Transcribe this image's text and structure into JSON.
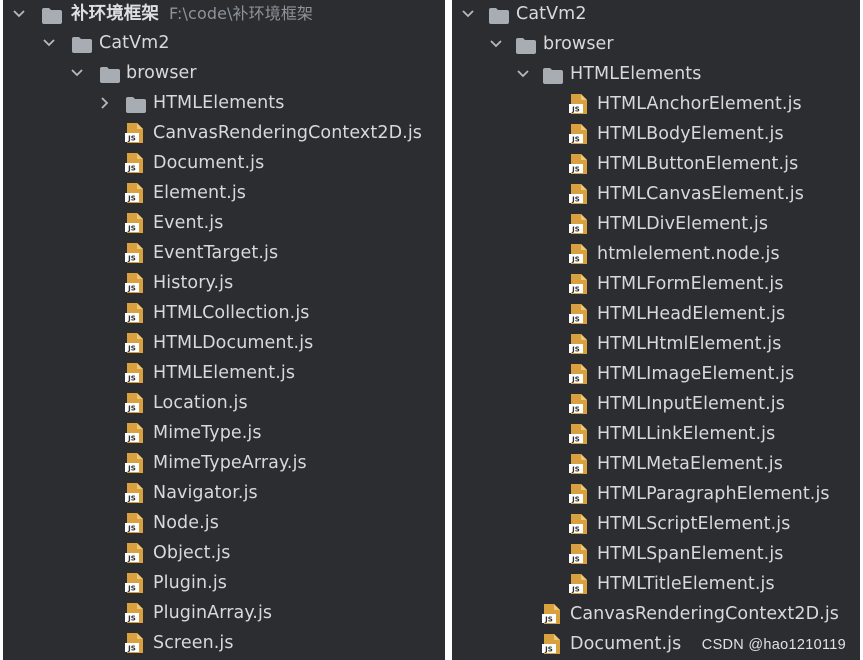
{
  "colors": {
    "panel_background": "#2b2d30",
    "text": "#d6d9de",
    "path_hint": "#8e939a",
    "folder_icon": "#a8adb4",
    "js_icon_fill": "#d8a03e",
    "js_icon_badge": "#ffffff",
    "chevron": "#b6bac1"
  },
  "left_panel": {
    "project": {
      "name": "补环境框架",
      "path": "F:\\code\\补环境框架"
    },
    "catvm2": "CatVm2",
    "browser": "browser",
    "html_elements_collapsed": "HTMLElements",
    "files": [
      "CanvasRenderingContext2D.js",
      "Document.js",
      "Element.js",
      "Event.js",
      "EventTarget.js",
      "History.js",
      "HTMLCollection.js",
      "HTMLDocument.js",
      "HTMLElement.js",
      "Location.js",
      "MimeType.js",
      "MimeTypeArray.js",
      "Navigator.js",
      "Node.js",
      "Object.js",
      "Plugin.js",
      "PluginArray.js",
      "Screen.js"
    ]
  },
  "right_panel": {
    "catvm2": "CatVm2",
    "browser": "browser",
    "html_elements_expanded": "HTMLElements",
    "element_files": [
      "HTMLAnchorElement.js",
      "HTMLBodyElement.js",
      "HTMLButtonElement.js",
      "HTMLCanvasElement.js",
      "HTMLDivElement.js",
      "htmlelement.node.js",
      "HTMLFormElement.js",
      "HTMLHeadElement.js",
      "HTMLHtmlElement.js",
      "HTMLImageElement.js",
      "HTMLInputElement.js",
      "HTMLLinkElement.js",
      "HTMLMetaElement.js",
      "HTMLParagraphElement.js",
      "HTMLScriptElement.js",
      "HTMLSpanElement.js",
      "HTMLTitleElement.js"
    ],
    "browser_files": [
      "CanvasRenderingContext2D.js",
      "Document.js"
    ]
  },
  "watermark": "CSDN @hao1210119"
}
